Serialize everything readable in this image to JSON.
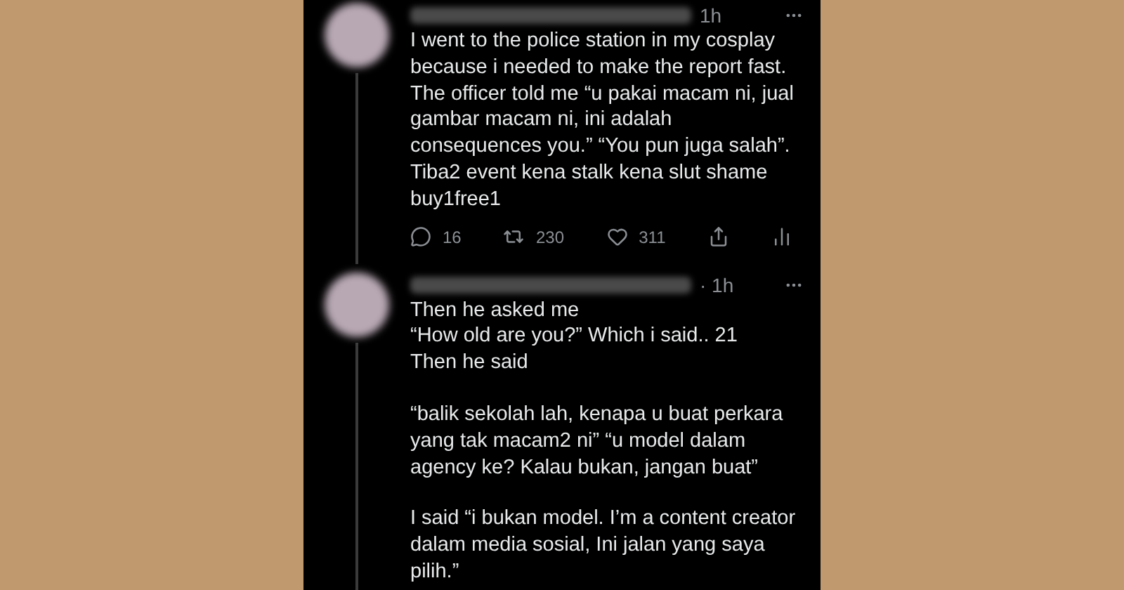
{
  "tweets": [
    {
      "time": "1h",
      "thread_line": true,
      "paragraphs": [
        [
          "I went to the police station in my cosplay",
          "because i needed to make the report fast.",
          "The officer told me “u pakai macam ni, jual",
          "gambar macam ni, ini adalah",
          "consequences you.” “You pun juga salah”.",
          "Tiba2 event kena stalk kena slut shame",
          "buy1free1"
        ]
      ],
      "actions": [
        {
          "kind": "reply",
          "count": "16"
        },
        {
          "kind": "retweet",
          "count": "230"
        },
        {
          "kind": "like",
          "count": "311"
        },
        {
          "kind": "share"
        },
        {
          "kind": "analytics"
        }
      ]
    },
    {
      "time": "· 1h",
      "thread_line": true,
      "paragraphs": [
        [
          "Then he asked me",
          "“How old are you?” Which i said.. 21",
          "Then he said"
        ],
        [
          "“balik sekolah lah, kenapa u buat perkara",
          "yang tak macam2 ni” “u model dalam",
          "agency ke? Kalau bukan, jangan buat”"
        ],
        [
          "I said “i bukan model. I’m a content creator",
          "dalam media sosial, Ini jalan yang saya",
          "pilih.”"
        ]
      ]
    }
  ]
}
